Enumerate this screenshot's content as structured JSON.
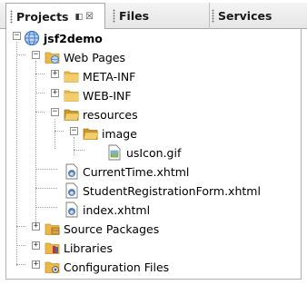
{
  "tabs": [
    {
      "label": "Projects",
      "ctrl_pin": "◧",
      "ctrl_close": "☒"
    },
    {
      "label": "Files"
    },
    {
      "label": "Services"
    }
  ],
  "tree": {
    "root": "jsf2demo",
    "web_pages": "Web Pages",
    "meta_inf": "META-INF",
    "web_inf": "WEB-INF",
    "resources": "resources",
    "image": "image",
    "usicon": "usIcon.gif",
    "current_time": "CurrentTime.xhtml",
    "student_reg": "StudentRegistrationForm.xhtml",
    "index": "index.xhtml",
    "source_packages": "Source Packages",
    "libraries": "Libraries",
    "config_files": "Configuration Files"
  },
  "colors": {
    "folder": "#e8b84a",
    "folder_dark": "#c9962b",
    "globe": "#3f78c9",
    "file_blue": "#5b84b4"
  }
}
